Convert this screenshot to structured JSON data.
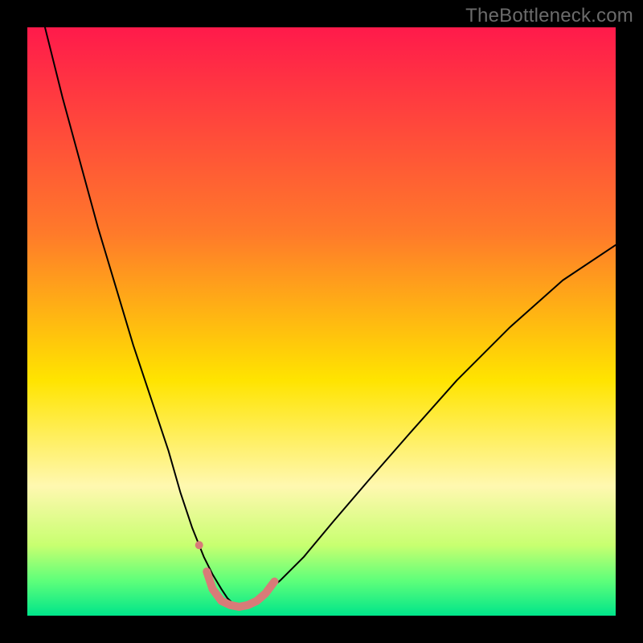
{
  "watermark": "TheBottleneck.com",
  "chart_data": {
    "type": "line",
    "title": "",
    "xlabel": "",
    "ylabel": "",
    "xlim": [
      0,
      100
    ],
    "ylim": [
      0,
      100
    ],
    "grid": false,
    "legend": false,
    "background": {
      "type": "vertical-gradient",
      "stops": [
        {
          "pos": 0,
          "color": "#ff1a4b"
        },
        {
          "pos": 35,
          "color": "#ff7a2a"
        },
        {
          "pos": 60,
          "color": "#ffe400"
        },
        {
          "pos": 78,
          "color": "#fff8b0"
        },
        {
          "pos": 88,
          "color": "#c8ff70"
        },
        {
          "pos": 94,
          "color": "#5fff7a"
        },
        {
          "pos": 100,
          "color": "#00e58a"
        }
      ]
    },
    "series": [
      {
        "name": "bottleneck-curve-left",
        "color": "#000000",
        "stroke_width": 2,
        "x": [
          3,
          6,
          9,
          12,
          15,
          18,
          21,
          24,
          26,
          28,
          30,
          31.5,
          33,
          34,
          35,
          36
        ],
        "y": [
          100,
          88,
          77,
          66,
          56,
          46,
          37,
          28,
          21,
          15,
          10,
          7,
          4.5,
          3,
          2,
          1.5
        ]
      },
      {
        "name": "bottleneck-curve-right",
        "color": "#000000",
        "stroke_width": 2,
        "x": [
          36,
          38,
          40,
          43,
          47,
          52,
          58,
          65,
          73,
          82,
          91,
          100
        ],
        "y": [
          1.5,
          2,
          3.5,
          6,
          10,
          16,
          23,
          31,
          40,
          49,
          57,
          63
        ]
      },
      {
        "name": "sweet-spot-band",
        "color": "#d87b78",
        "stroke_width": 10,
        "x": [
          30.5,
          31.5,
          33,
          34.5,
          36,
          37.5,
          39,
          40.5,
          42
        ],
        "y": [
          7.5,
          4.5,
          2.5,
          1.8,
          1.5,
          1.8,
          2.5,
          3.8,
          5.8
        ]
      }
    ],
    "markers": [
      {
        "name": "sweet-spot-dot",
        "x": 29.2,
        "y": 12,
        "r": 5,
        "color": "#d87b78"
      }
    ]
  }
}
